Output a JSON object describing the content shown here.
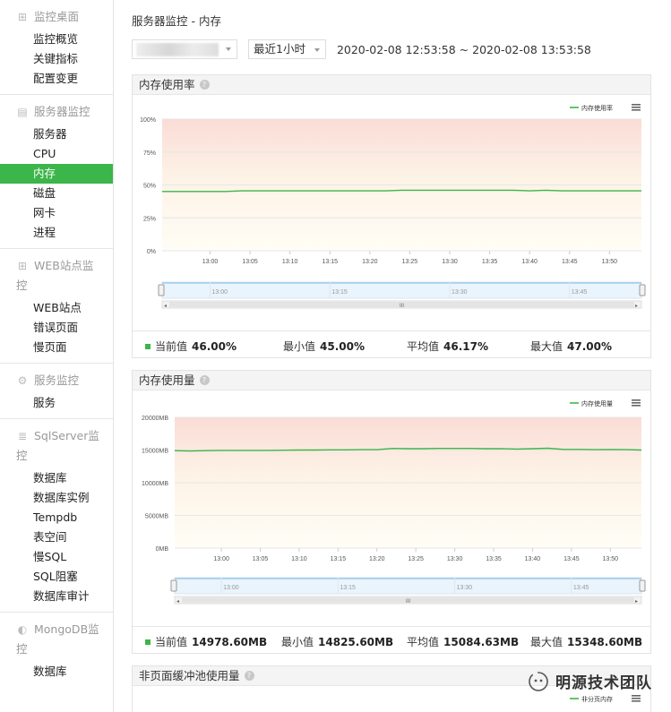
{
  "sidebar": {
    "groups": [
      {
        "title": "监控桌面",
        "icon": "desktop-icon",
        "items": [
          "监控概览",
          "关键指标",
          "配置变更"
        ]
      },
      {
        "title": "服务器监控",
        "icon": "server-icon",
        "items": [
          "服务器",
          "CPU",
          "内存",
          "磁盘",
          "网卡",
          "进程"
        ]
      },
      {
        "title": "WEB站点监控",
        "icon": "grid-icon",
        "items": [
          "WEB站点",
          "错误页面",
          "慢页面"
        ]
      },
      {
        "title": "服务监控",
        "icon": "gear-icon",
        "items": [
          "服务"
        ]
      },
      {
        "title": "SqlServer监控",
        "icon": "database-icon",
        "items": [
          "数据库",
          "数据库实例",
          "Tempdb",
          "表空间",
          "慢SQL",
          "SQL阻塞",
          "数据库审计"
        ]
      },
      {
        "title": "MongoDB监控",
        "icon": "mongodb-icon",
        "items": [
          "数据库"
        ]
      }
    ],
    "active_item": "内存"
  },
  "header": {
    "title": "服务器监控 - 内存",
    "range_select": "最近1小时",
    "time_range": "2020-02-08 12:53:58 ~ 2020-02-08 13:53:58"
  },
  "panels": [
    {
      "title": "内存使用率",
      "stats": {
        "current_label": "当前值",
        "current": "46.00%",
        "min_label": "最小值",
        "min": "45.00%",
        "avg_label": "平均值",
        "avg": "46.17%",
        "max_label": "最大值",
        "max": "47.00%"
      }
    },
    {
      "title": "内存使用量",
      "stats": {
        "current_label": "当前值",
        "current": "14978.60MB",
        "min_label": "最小值",
        "min": "14825.60MB",
        "avg_label": "平均值",
        "avg": "15084.63MB",
        "max_label": "最大值",
        "max": "15348.60MB"
      }
    },
    {
      "title": "非页面缓冲池使用量"
    }
  ],
  "chart_data": [
    {
      "type": "line",
      "series": [
        {
          "name": "内存使用率",
          "color": "#3cb54a"
        }
      ],
      "x": [
        "12:54",
        "12:56",
        "12:58",
        "13:00",
        "13:02",
        "13:04",
        "13:06",
        "13:08",
        "13:10",
        "13:12",
        "13:14",
        "13:16",
        "13:18",
        "13:20",
        "13:22",
        "13:24",
        "13:26",
        "13:28",
        "13:30",
        "13:32",
        "13:34",
        "13:36",
        "13:38",
        "13:40",
        "13:42",
        "13:44",
        "13:46",
        "13:48",
        "13:50",
        "13:52",
        "13:54"
      ],
      "values": [
        45,
        45,
        45,
        45,
        45,
        45.5,
        45.5,
        45.5,
        45.5,
        45.5,
        45.5,
        45.5,
        45.5,
        45.5,
        45.5,
        46,
        46,
        46,
        46,
        46,
        46,
        46,
        46,
        45.5,
        46,
        45.5,
        45.5,
        45.5,
        45.5,
        45.5,
        45.5
      ],
      "xticks": [
        "13:00",
        "13:05",
        "13:10",
        "13:15",
        "13:20",
        "13:25",
        "13:30",
        "13:35",
        "13:40",
        "13:45",
        "13:50"
      ],
      "yticks": [
        "0%",
        "25%",
        "50%",
        "75%",
        "100%"
      ],
      "ylim": [
        0,
        100
      ],
      "legend": "top-right",
      "navigator_ticks": [
        "13:00",
        "13:15",
        "13:30",
        "13:45"
      ],
      "navigator_grip": "III"
    },
    {
      "type": "line",
      "series": [
        {
          "name": "内存使用量",
          "color": "#3cb54a"
        }
      ],
      "x": [
        "12:54",
        "12:56",
        "12:58",
        "13:00",
        "13:02",
        "13:04",
        "13:06",
        "13:08",
        "13:10",
        "13:12",
        "13:14",
        "13:16",
        "13:18",
        "13:20",
        "13:22",
        "13:24",
        "13:26",
        "13:28",
        "13:30",
        "13:32",
        "13:34",
        "13:36",
        "13:38",
        "13:40",
        "13:42",
        "13:44",
        "13:46",
        "13:48",
        "13:50",
        "13:52",
        "13:54"
      ],
      "values": [
        14900,
        14850,
        14900,
        14950,
        14950,
        14950,
        14950,
        14975,
        15000,
        15000,
        15025,
        15025,
        15050,
        15050,
        15250,
        15200,
        15200,
        15250,
        15250,
        15250,
        15200,
        15225,
        15150,
        15200,
        15275,
        15100,
        15100,
        15050,
        15075,
        15050,
        15000
      ],
      "xticks": [
        "13:00",
        "13:05",
        "13:10",
        "13:15",
        "13:20",
        "13:25",
        "13:30",
        "13:35",
        "13:40",
        "13:45",
        "13:50"
      ],
      "yticks": [
        "0MB",
        "5000MB",
        "10000MB",
        "15000MB",
        "20000MB"
      ],
      "ylim": [
        0,
        20000
      ],
      "legend": "top-right",
      "navigator_ticks": [
        "13:00",
        "13:15",
        "13:30",
        "13:45"
      ],
      "navigator_grip": "III"
    },
    {
      "type": "line",
      "series": [
        {
          "name": "非分页内存",
          "color": "#3cb54a"
        }
      ],
      "legend": "top-right"
    }
  ],
  "watermark": {
    "text": "明源技术团队",
    "icon": "wechat-icon"
  }
}
